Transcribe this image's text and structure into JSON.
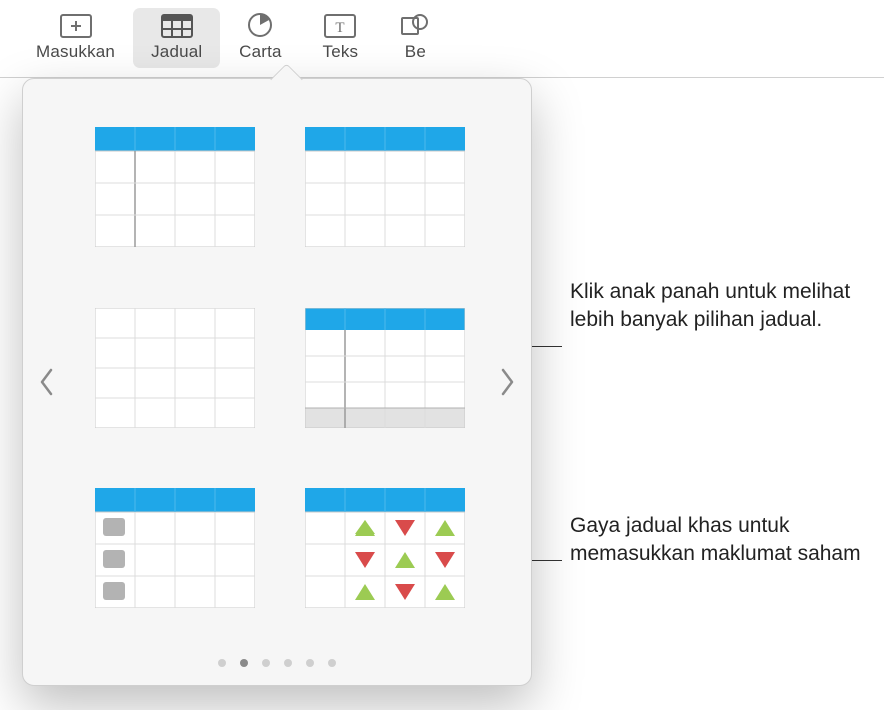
{
  "toolbar": {
    "items": [
      {
        "label": "Masukkan",
        "icon": "insert-icon"
      },
      {
        "label": "Jadual",
        "icon": "table-icon",
        "active": true
      },
      {
        "label": "Carta",
        "icon": "chart-icon"
      },
      {
        "label": "Teks",
        "icon": "text-icon"
      },
      {
        "label": "Be",
        "icon": "shape-icon"
      }
    ]
  },
  "popover": {
    "page_dots": 6,
    "active_dot": 1,
    "styles": [
      "table-style-header-blue-column",
      "table-style-header-blue",
      "table-style-plain",
      "table-style-header-footer",
      "table-style-checklist",
      "table-style-stock"
    ]
  },
  "callouts": {
    "arrow_hint": "Klik anak panah untuk melihat lebih banyak pilihan jadual.",
    "stock_hint": "Gaya jadual khas untuk memasukkan maklumat saham"
  },
  "colors": {
    "accent": "#1FA7E8",
    "row_alt": "#EFEFEF",
    "border": "#B9B9B9",
    "up": "#9CCB53",
    "down": "#D94B4B"
  }
}
